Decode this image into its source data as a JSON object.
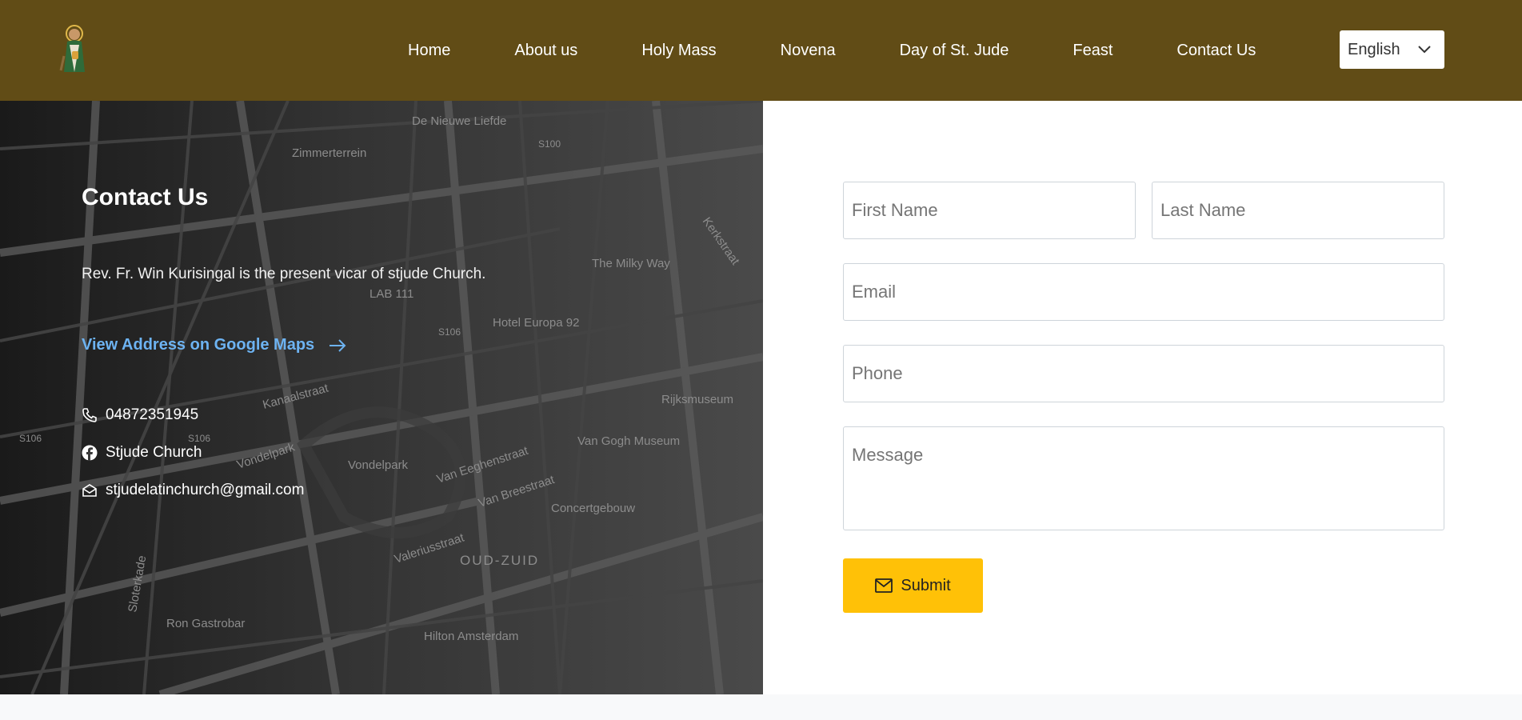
{
  "header": {
    "nav": [
      "Home",
      "About us",
      "Holy Mass",
      "Novena",
      "Day of St. Jude",
      "Feast",
      "Contact Us"
    ],
    "language": "English"
  },
  "contact": {
    "title": "Contact Us",
    "vicar_text": "Rev. Fr. Win Kurisingal is the present vicar of stjude Church.",
    "map_link": "View Address on Google Maps",
    "phone": "04872351945",
    "facebook": "Stjude Church",
    "email": "stjudelatinchurch@gmail.com"
  },
  "map_labels": [
    "De Nieuwe Liefde",
    "Zimmerterrein",
    "S100",
    "The Milky Way",
    "Kerkstraat",
    "LAB 111",
    "S106",
    "Hotel Europa 92",
    "Rijksmuseum",
    "Van Gogh Museum",
    "Vondelpark",
    "Van Eeghenstraat",
    "Van Breestraat",
    "Concertgebouw",
    "Valeriusstraat",
    "OUD-ZUID",
    "Ron Gastrobar",
    "Hilton Amsterdam",
    "Vondelpark",
    "Sloterkade",
    "Kanaalstraat"
  ],
  "form": {
    "first_name_placeholder": "First Name",
    "last_name_placeholder": "Last Name",
    "email_placeholder": "Email",
    "phone_placeholder": "Phone",
    "message_placeholder": "Message",
    "submit_label": "Submit"
  },
  "colors": {
    "header_bg": "#614c16",
    "link": "#6db3f2",
    "submit_bg": "#ffc107"
  },
  "icons": [
    "saint-logo-icon",
    "chevron-down-icon",
    "arrow-right-icon",
    "phone-icon",
    "facebook-icon",
    "mail-icon",
    "envelope-icon"
  ]
}
